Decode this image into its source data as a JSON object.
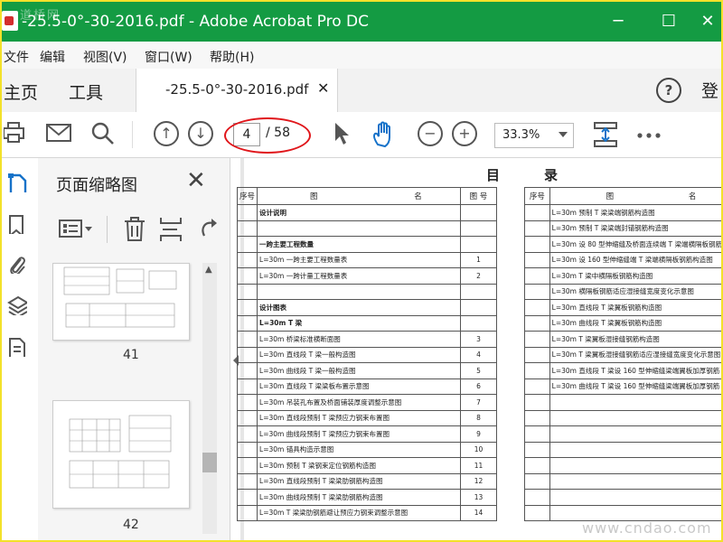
{
  "window": {
    "title": "-25.5-0°-30-2016.pdf - Adobe Acrobat Pro DC",
    "watermark": "道桥网",
    "minimize": "─",
    "maximize": "☐",
    "close": "✕"
  },
  "menu": {
    "items": [
      "文件",
      "编辑",
      "视图(V)",
      "窗口(W)",
      "帮助(H)"
    ]
  },
  "tabs": {
    "home": "主页",
    "tools": "工具",
    "document": "-25.5-0°-30-2016.pdf",
    "close": "✕",
    "help": "?",
    "login": "登"
  },
  "toolbar": {
    "current_page": "4",
    "total_pages": "/ 58",
    "zoom": "33.3%"
  },
  "thumbnails": {
    "title": "页面缩略图",
    "close": "✕",
    "pages": [
      "41",
      "42"
    ]
  },
  "document": {
    "heading_a": "目",
    "heading_b": "录",
    "left_table": {
      "header": [
        "序号",
        "图",
        "名",
        "图 号"
      ],
      "rows": [
        {
          "name": "设计说明",
          "no": "",
          "bold": true
        },
        {
          "name": "",
          "no": ""
        },
        {
          "name": "一跨主要工程数量",
          "no": "",
          "bold": true
        },
        {
          "name": "L=30m 一跨主要工程数量表",
          "no": "1"
        },
        {
          "name": "L=30m 一跨计量工程数量表",
          "no": "2"
        },
        {
          "name": "",
          "no": ""
        },
        {
          "name": "设计图表",
          "no": "",
          "bold": true
        },
        {
          "name": "L=30m T 梁",
          "no": "",
          "bold": true
        },
        {
          "name": "L=30m 桥梁标准横断面图",
          "no": "3"
        },
        {
          "name": "L=30m 直线段 T 梁一般构造图",
          "no": "4"
        },
        {
          "name": "L=30m 曲线段 T 梁一般构造图",
          "no": "5"
        },
        {
          "name": "L=30m 直线段 T 梁梁板布置示意图",
          "no": "6"
        },
        {
          "name": "L=30m 吊装孔布置及桥面铺装厚度调整示意图",
          "no": "7"
        },
        {
          "name": "L=30m 直线段预制 T 梁预应力钢束布置图",
          "no": "8"
        },
        {
          "name": "L=30m 曲线段预制 T 梁预应力钢束布置图",
          "no": "9"
        },
        {
          "name": "L=30m 锚具构造示意图",
          "no": "10"
        },
        {
          "name": "L=30m 预制 T 梁钢束定位钢筋构造图",
          "no": "11"
        },
        {
          "name": "L=30m 直线段预制 T 梁梁肋钢筋构造图",
          "no": "12"
        },
        {
          "name": "L=30m 曲线段预制 T 梁梁肋钢筋构造图",
          "no": "13"
        },
        {
          "name": "L=30m T 梁梁肋钢筋避让预应力钢束调整示意图",
          "no": "14"
        }
      ]
    },
    "right_table": {
      "header": [
        "序号",
        "图",
        "名"
      ],
      "rows": [
        "L=30m 预制 T 梁梁端钢筋构造图",
        "L=30m 预制 T 梁梁端封锚钢筋构造图",
        "L=30m 设 80 型伸缩缝及桥面连续端 T 梁端横隔板钢筋",
        "L=30m 设 160 型伸缩缝端 T 梁端横隔板钢筋构造图",
        "L=30m T 梁中横隔板钢筋构造图",
        "L=30m 横隔板钢筋适应湿接缝宽度变化示意图",
        "L=30m 直线段 T 梁翼板钢筋构造图",
        "L=30m 曲线段 T 梁翼板钢筋构造图",
        "L=30m T 梁翼板湿接缝钢筋构造图",
        "L=30m T 梁翼板湿接缝钢筋适应湿接缝宽度变化示意图",
        "L=30m 直线段 T 梁设 160 型伸缩缝梁端翼板加厚钢筋",
        "L=30m 曲线段 T 梁设 160 型伸缩缝梁端翼板加厚钢筋",
        "",
        "",
        "",
        "",
        "",
        "",
        "",
        ""
      ]
    },
    "watermark": "www.cndao.com"
  },
  "colors": {
    "titlebar": "#149b43",
    "highlight_oval": "#e0161b",
    "border": "#f3e12a"
  }
}
